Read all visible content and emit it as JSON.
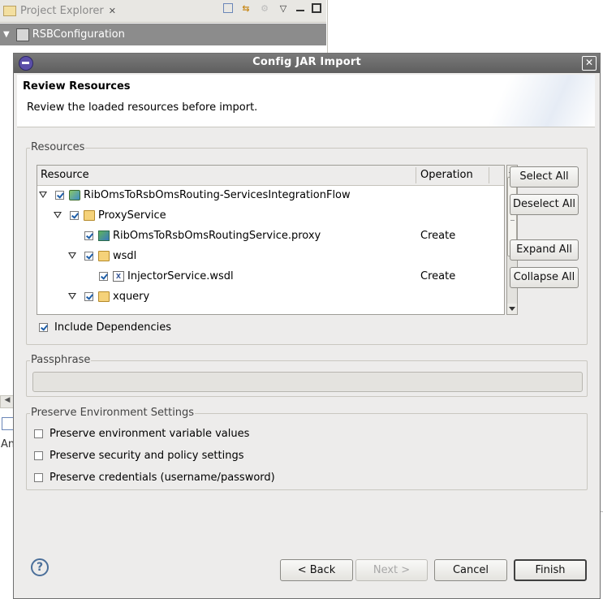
{
  "background": {
    "project_explorer_tab": "Project Explorer",
    "tree_root": "RSBConfiguration",
    "partial_text": "An"
  },
  "dialog": {
    "title": "Config JAR Import",
    "header_title": "Review Resources",
    "header_description": "Review the loaded resources before import.",
    "resources_group": "Resources",
    "columns": {
      "resource": "Resource",
      "operation": "Operation"
    },
    "rows": [
      {
        "label": "RibOmsToRsbOmsRouting-ServicesIntegrationFlow",
        "operation": "",
        "icon": "flow-icon"
      },
      {
        "label": "ProxyService",
        "operation": "",
        "icon": "folder-icon"
      },
      {
        "label": "RibOmsToRsbOmsRoutingService.proxy",
        "operation": "Create",
        "icon": "proxy-icon"
      },
      {
        "label": "wsdl",
        "operation": "",
        "icon": "folder-icon"
      },
      {
        "label": "InjectorService.wsdl",
        "operation": "Create",
        "icon": "wsdl-file-icon"
      },
      {
        "label": "xquery",
        "operation": "",
        "icon": "folder-icon"
      }
    ],
    "buttons_side": {
      "select_all": "Select All",
      "deselect_all": "Deselect All",
      "expand_all": "Expand All",
      "collapse_all": "Collapse All"
    },
    "include_dependencies": "Include Dependencies",
    "passphrase_group": "Passphrase",
    "passphrase_value": "",
    "preserve_group": "Preserve Environment Settings",
    "preserve_options": [
      "Preserve environment variable values",
      "Preserve security and policy settings",
      "Preserve credentials (username/password)"
    ],
    "footer": {
      "back": "< Back",
      "next": "Next >",
      "cancel": "Cancel",
      "finish": "Finish"
    }
  }
}
